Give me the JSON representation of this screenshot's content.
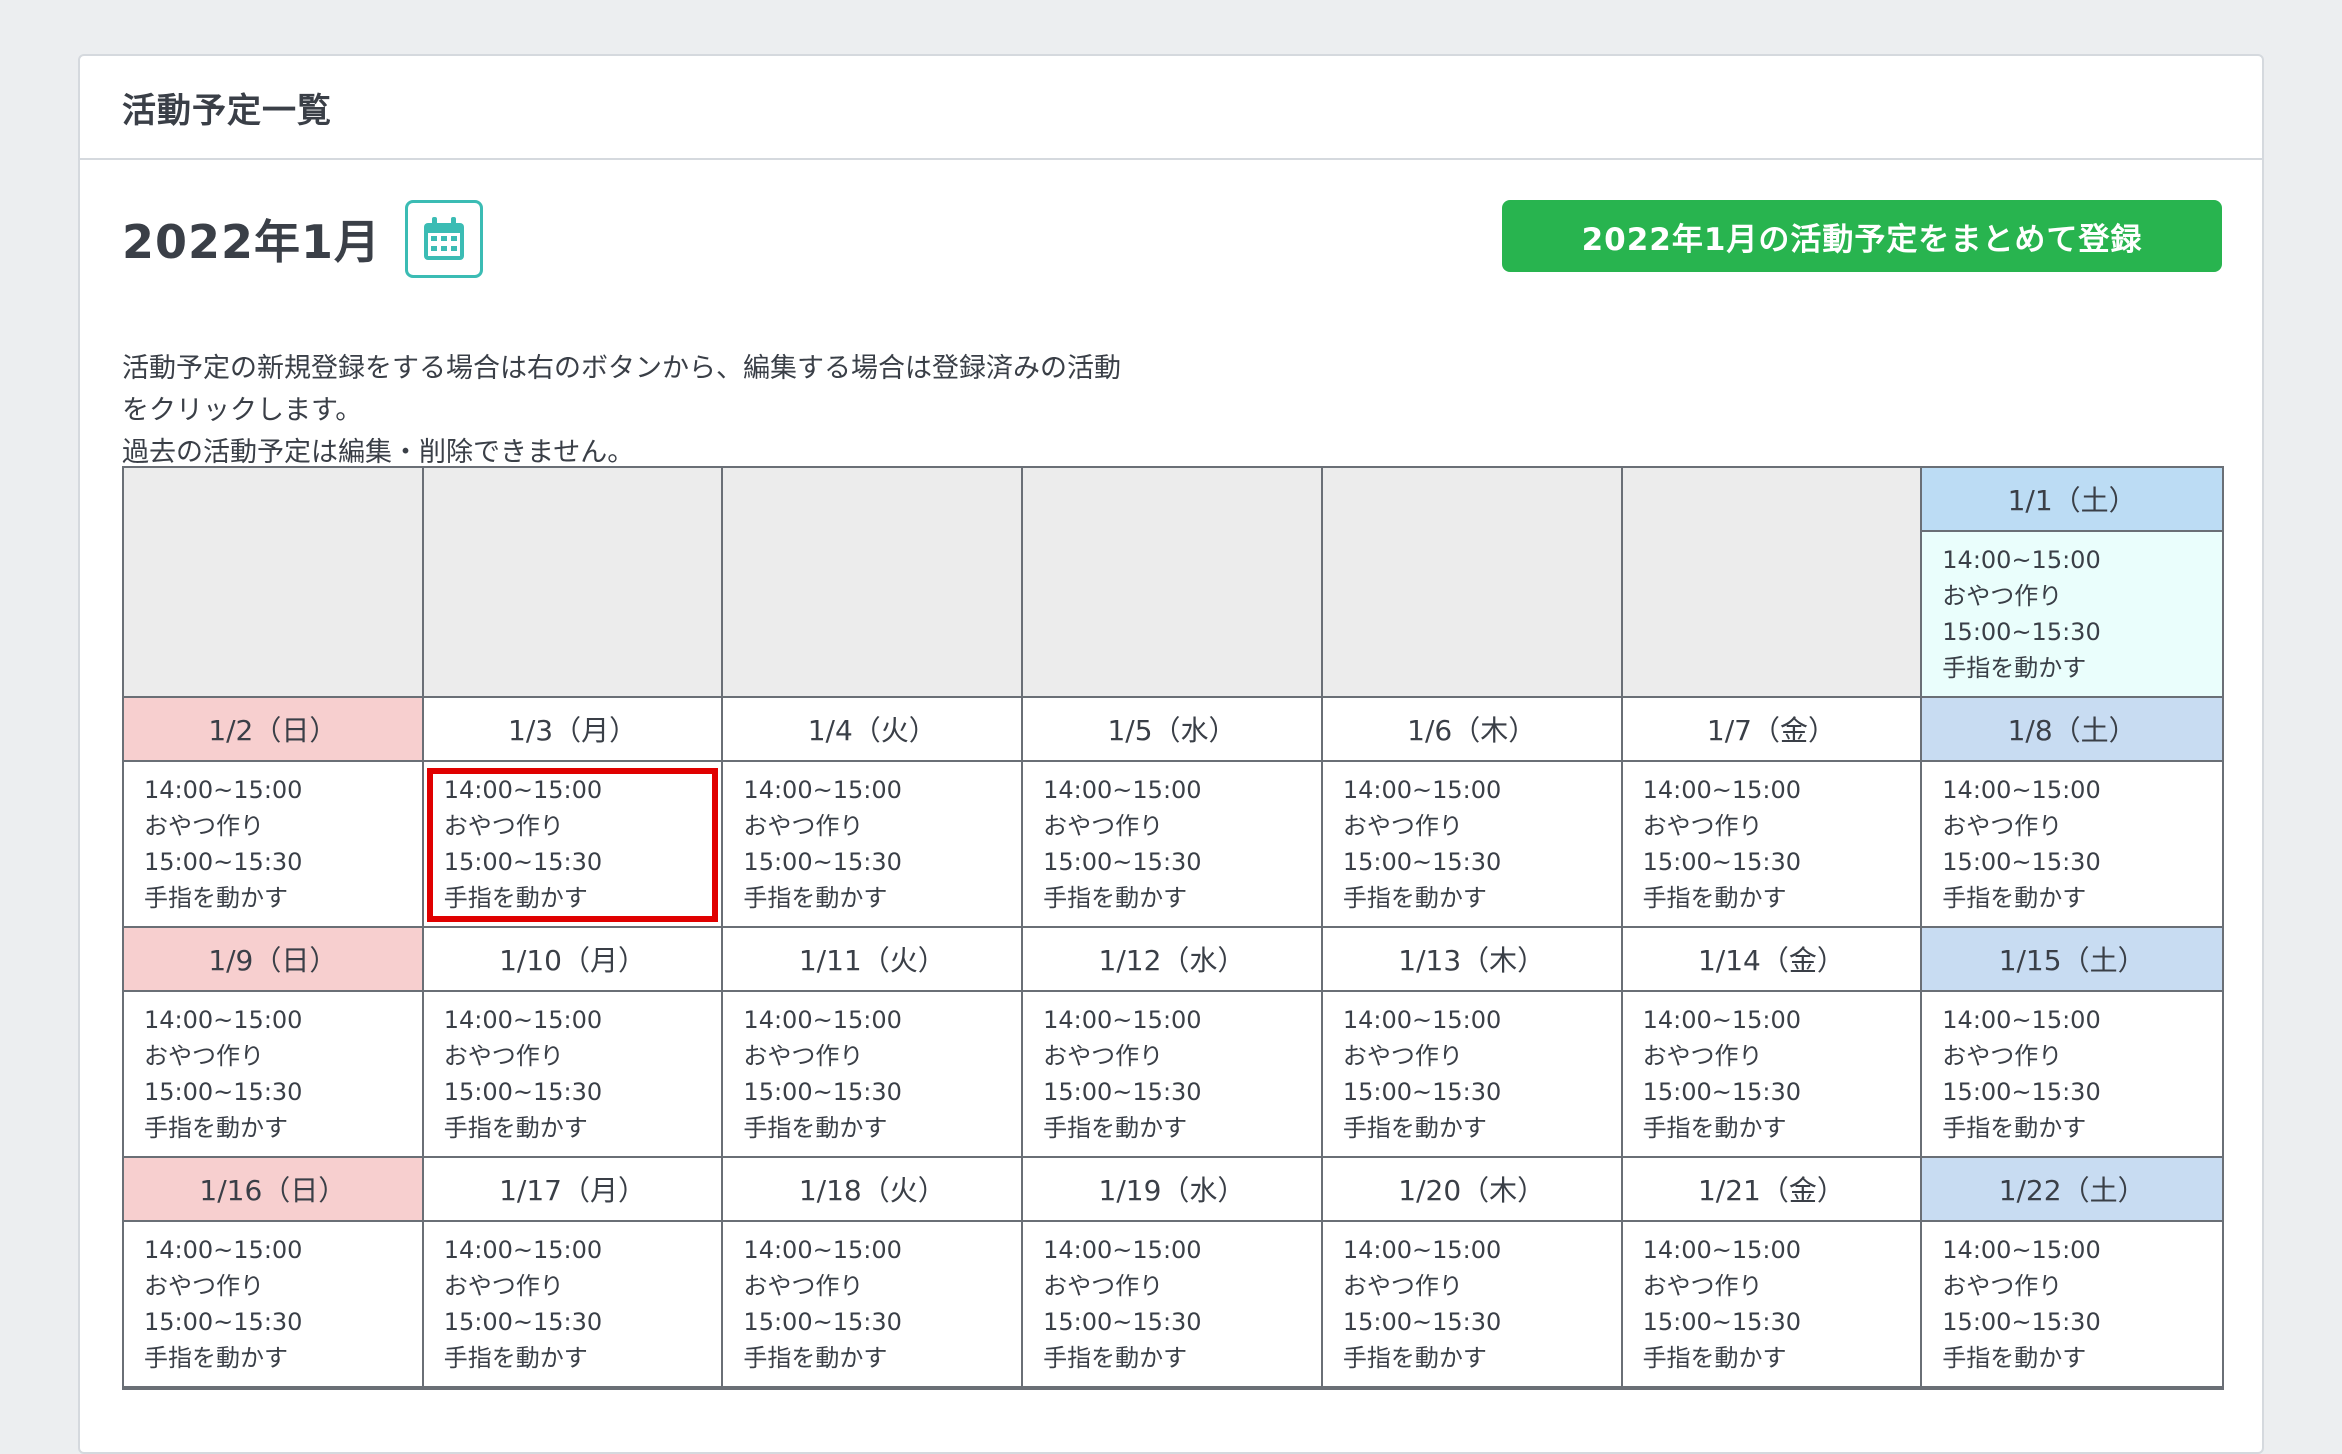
{
  "card": {
    "title": "活動予定一覧"
  },
  "month": {
    "title": "2022年1月",
    "calendar_icon": "calendar-icon",
    "bulk_button_label": "2022年1月の活動予定をまとめて登録"
  },
  "description": {
    "line1": "活動予定の新規登録をする場合は右のボタンから、編集する場合は登録済みの活動",
    "line2": "をクリックします。",
    "line3": "過去の活動予定は編集・削除できません。"
  },
  "colors": {
    "accent_green": "#28b44f",
    "calendar_icon_teal": "#3bbcb4",
    "sunday_header": "#f7cfcf",
    "saturday_header": "#c8dcf2",
    "selection_border": "#e00000"
  },
  "week1": {
    "sat": {
      "date": "1/1（土）",
      "act1_time": "14:00~15:00",
      "act1_name": "おやつ作り",
      "act2_time": "15:00~15:30",
      "act2_name": "手指を動かす"
    }
  },
  "week2": {
    "sun": {
      "date": "1/2（日）",
      "act1_time": "14:00~15:00",
      "act1_name": "おやつ作り",
      "act2_time": "15:00~15:30",
      "act2_name": "手指を動かす"
    },
    "mon": {
      "date": "1/3（月）",
      "act1_time": "14:00~15:00",
      "act1_name": "おやつ作り",
      "act2_time": "15:00~15:30",
      "act2_name": "手指を動かす"
    },
    "tue": {
      "date": "1/4（火）",
      "act1_time": "14:00~15:00",
      "act1_name": "おやつ作り",
      "act2_time": "15:00~15:30",
      "act2_name": "手指を動かす"
    },
    "wed": {
      "date": "1/5（水）",
      "act1_time": "14:00~15:00",
      "act1_name": "おやつ作り",
      "act2_time": "15:00~15:30",
      "act2_name": "手指を動かす"
    },
    "thu": {
      "date": "1/6（木）",
      "act1_time": "14:00~15:00",
      "act1_name": "おやつ作り",
      "act2_time": "15:00~15:30",
      "act2_name": "手指を動かす"
    },
    "fri": {
      "date": "1/7（金）",
      "act1_time": "14:00~15:00",
      "act1_name": "おやつ作り",
      "act2_time": "15:00~15:30",
      "act2_name": "手指を動かす"
    },
    "sat": {
      "date": "1/8（土）",
      "act1_time": "14:00~15:00",
      "act1_name": "おやつ作り",
      "act2_time": "15:00~15:30",
      "act2_name": "手指を動かす"
    }
  },
  "week3": {
    "sun": {
      "date": "1/9（日）",
      "act1_time": "14:00~15:00",
      "act1_name": "おやつ作り",
      "act2_time": "15:00~15:30",
      "act2_name": "手指を動かす"
    },
    "mon": {
      "date": "1/10（月）",
      "act1_time": "14:00~15:00",
      "act1_name": "おやつ作り",
      "act2_time": "15:00~15:30",
      "act2_name": "手指を動かす"
    },
    "tue": {
      "date": "1/11（火）",
      "act1_time": "14:00~15:00",
      "act1_name": "おやつ作り",
      "act2_time": "15:00~15:30",
      "act2_name": "手指を動かす"
    },
    "wed": {
      "date": "1/12（水）",
      "act1_time": "14:00~15:00",
      "act1_name": "おやつ作り",
      "act2_time": "15:00~15:30",
      "act2_name": "手指を動かす"
    },
    "thu": {
      "date": "1/13（木）",
      "act1_time": "14:00~15:00",
      "act1_name": "おやつ作り",
      "act2_time": "15:00~15:30",
      "act2_name": "手指を動かす"
    },
    "fri": {
      "date": "1/14（金）",
      "act1_time": "14:00~15:00",
      "act1_name": "おやつ作り",
      "act2_time": "15:00~15:30",
      "act2_name": "手指を動かす"
    },
    "sat": {
      "date": "1/15（土）",
      "act1_time": "14:00~15:00",
      "act1_name": "おやつ作り",
      "act2_time": "15:00~15:30",
      "act2_name": "手指を動かす"
    }
  },
  "week4": {
    "sun": {
      "date": "1/16（日）",
      "act1_time": "14:00~15:00",
      "act1_name": "おやつ作り",
      "act2_time": "15:00~15:30",
      "act2_name": "手指を動かす"
    },
    "mon": {
      "date": "1/17（月）",
      "act1_time": "14:00~15:00",
      "act1_name": "おやつ作り",
      "act2_time": "15:00~15:30",
      "act2_name": "手指を動かす"
    },
    "tue": {
      "date": "1/18（火）",
      "act1_time": "14:00~15:00",
      "act1_name": "おやつ作り",
      "act2_time": "15:00~15:30",
      "act2_name": "手指を動かす"
    },
    "wed": {
      "date": "1/19（水）",
      "act1_time": "14:00~15:00",
      "act1_name": "おやつ作り",
      "act2_time": "15:00~15:30",
      "act2_name": "手指を動かす"
    },
    "thu": {
      "date": "1/20（木）",
      "act1_time": "14:00~15:00",
      "act1_name": "おやつ作り",
      "act2_time": "15:00~15:30",
      "act2_name": "手指を動かす"
    },
    "fri": {
      "date": "1/21（金）",
      "act1_time": "14:00~15:00",
      "act1_name": "おやつ作り",
      "act2_time": "15:00~15:30",
      "act2_name": "手指を動かす"
    },
    "sat": {
      "date": "1/22（土）",
      "act1_time": "14:00~15:00",
      "act1_name": "おやつ作り",
      "act2_time": "15:00~15:30",
      "act2_name": "手指を動かす"
    }
  }
}
